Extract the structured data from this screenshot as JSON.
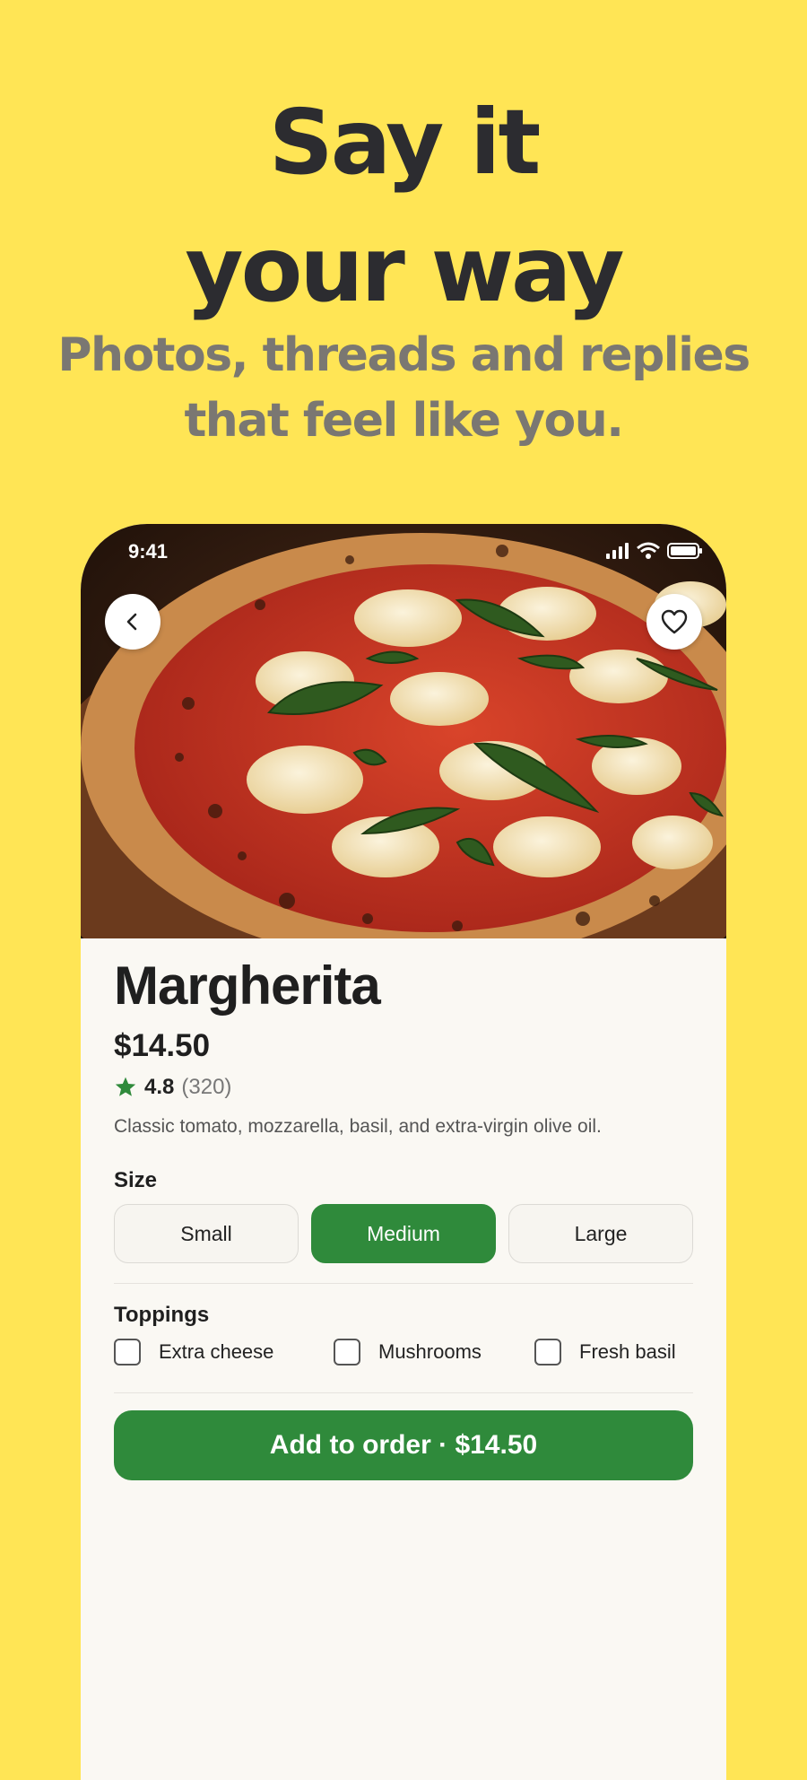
{
  "hero": {
    "title_line1": "Say it",
    "title_line2": "your way",
    "subtitle_line1": "Photos, threads and replies",
    "subtitle_line2": "that feel like you."
  },
  "status_bar": {
    "time": "9:41",
    "icons": [
      "signal-icon",
      "wifi-icon",
      "battery-icon"
    ]
  },
  "product": {
    "name": "Margherita",
    "price": "$14.50",
    "rating": "4.8",
    "rating_count": "(320)",
    "description": "Classic tomato, mozzarella, basil, and extra-virgin olive oil."
  },
  "size": {
    "label": "Size",
    "options": [
      "Small",
      "Medium",
      "Large"
    ],
    "selected": "Medium"
  },
  "toppings": {
    "label": "Toppings",
    "options": [
      {
        "label": "Extra cheese",
        "checked": false
      },
      {
        "label": "Mushrooms",
        "checked": false
      },
      {
        "label": "Fresh basil",
        "checked": false
      }
    ]
  },
  "cta": {
    "label": "Add to order · $14.50"
  },
  "colors": {
    "background": "#FFE555",
    "accent_green": "#2F8A3B",
    "headline": "#2C2C30",
    "subhead": "#7A7772"
  }
}
